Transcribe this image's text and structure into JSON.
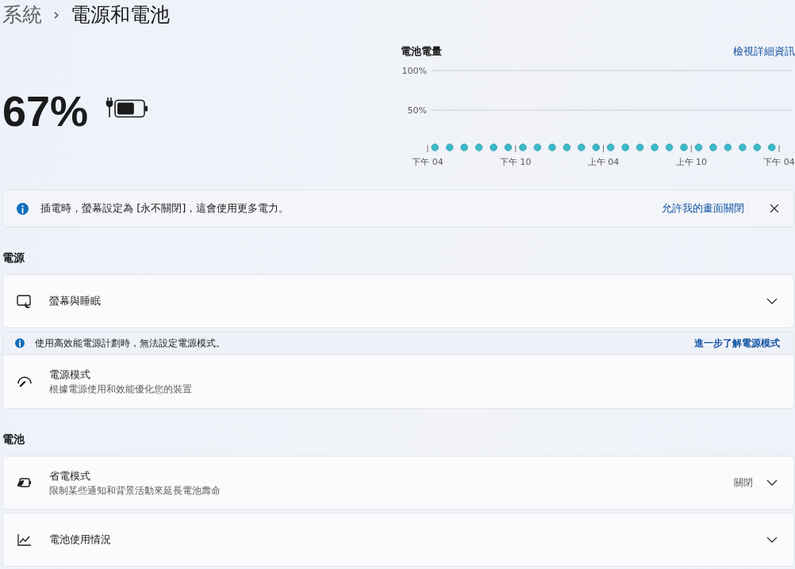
{
  "breadcrumb": {
    "parent": "系統",
    "separator": "›",
    "current": "電源和電池"
  },
  "battery": {
    "percent": "67%",
    "level": 0.67,
    "charging": true
  },
  "usage": {
    "title": "電池電量",
    "link": "檢視詳細資訊",
    "y_labels": [
      "100%",
      "50%"
    ],
    "x_labels": [
      "下午 04",
      "下午 10",
      "上午 04",
      "上午 10",
      "下午 04"
    ]
  },
  "notice": {
    "text": "插電時，螢幕設定為 [永不關閉]，這會使用更多電力。",
    "action": "允許我的畫面關閉",
    "dismissible": true
  },
  "sections": [
    {
      "title": "電源",
      "cards": [
        {
          "kind": "expander",
          "title": "螢幕與睡眠",
          "expanded": false
        },
        {
          "kind": "setting",
          "notice": {
            "text": "使用高效能電源計劃時，無法設定電源模式。",
            "link": "進一步了解電源模式"
          },
          "title": "電源模式",
          "subtitle": "根據電源使用和效能優化您的裝置"
        }
      ]
    },
    {
      "title": "電池",
      "cards": [
        {
          "kind": "expander",
          "title": "省電模式",
          "subtitle": "限制某些通知和背景活動來延長電池壽命",
          "value": "關閉",
          "expanded": false
        },
        {
          "kind": "expander",
          "title": "電池使用情況",
          "expanded": false
        }
      ]
    }
  ]
}
